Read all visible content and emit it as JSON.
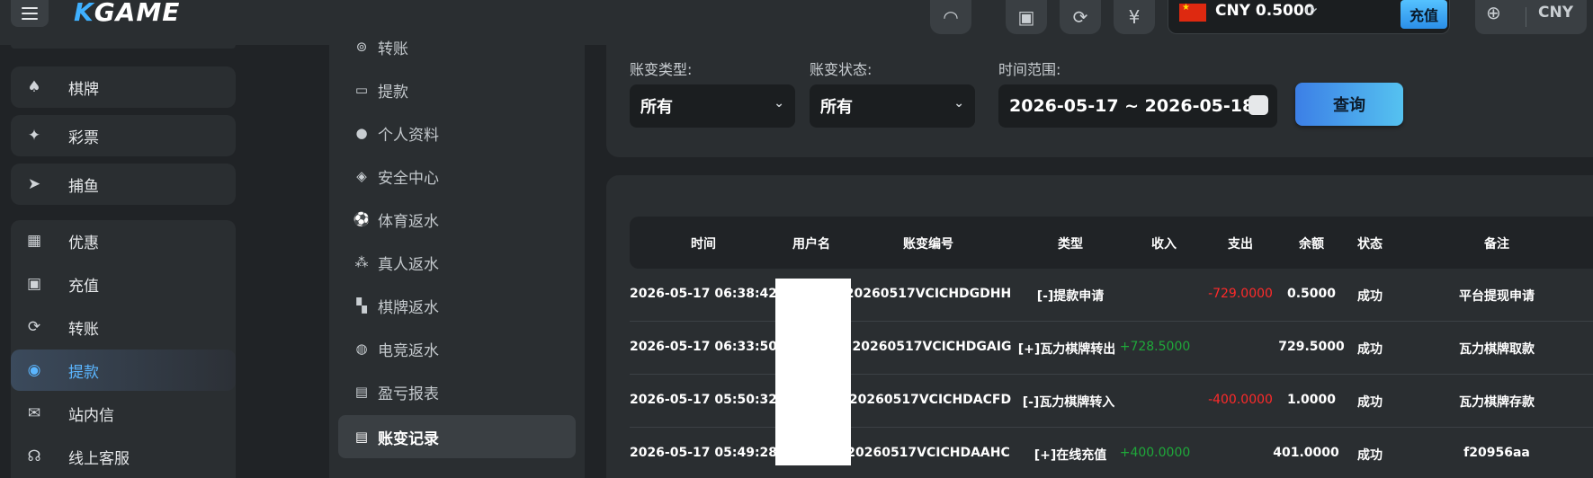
{
  "header": {
    "logo_k": "K",
    "logo_rest": "GAME",
    "balance": "CNY 0.5000",
    "recharge_label": "充值",
    "currency": "CNY"
  },
  "sidebar": {
    "items": [
      {
        "label": "棋牌",
        "icon": "cards-icon"
      },
      {
        "label": "彩票",
        "icon": "lottery-icon"
      },
      {
        "label": "捕鱼",
        "icon": "fish-icon"
      },
      {
        "label": "优惠",
        "icon": "gift-icon"
      },
      {
        "label": "充值",
        "icon": "wallet-icon"
      },
      {
        "label": "转账",
        "icon": "transfer-icon"
      },
      {
        "label": "提款",
        "icon": "withdraw-icon"
      },
      {
        "label": "站内信",
        "icon": "mail-icon"
      },
      {
        "label": "线上客服",
        "icon": "headset-icon"
      }
    ]
  },
  "submenu": {
    "items": [
      {
        "label": "转账"
      },
      {
        "label": "提款"
      },
      {
        "label": "个人资料"
      },
      {
        "label": "安全中心"
      },
      {
        "label": "体育返水"
      },
      {
        "label": "真人返水"
      },
      {
        "label": "棋牌返水"
      },
      {
        "label": "电竞返水"
      },
      {
        "label": "盈亏报表"
      },
      {
        "label": "账变记录"
      }
    ]
  },
  "filters": {
    "type_label": "账变类型:",
    "type_value": "所有",
    "status_label": "账变状态:",
    "status_value": "所有",
    "range_label": "时间范围:",
    "range_value": "2026-05-17 ~ 2026-05-18",
    "query_label": "查询"
  },
  "table": {
    "headers": [
      "时间",
      "用户名",
      "账变编号",
      "类型",
      "收入",
      "支出",
      "余额",
      "状态",
      "备注"
    ],
    "rows": [
      {
        "time": "2026-05-17 06:38:42",
        "user": "",
        "no": "20260517VCICHDGDHH",
        "type": "[-]提款申请",
        "income": "",
        "expense": "-729.0000",
        "balance": "0.5000",
        "status": "成功",
        "note": "平台提现申请"
      },
      {
        "time": "2026-05-17 06:33:50",
        "user": "",
        "no": "20260517VCICHDGAIG",
        "type": "[+]瓦力棋牌转出",
        "income": "+728.5000",
        "expense": "",
        "balance": "729.5000",
        "status": "成功",
        "note": "瓦力棋牌取款"
      },
      {
        "time": "2026-05-17 05:50:32",
        "user": "",
        "no": "20260517VCICHDACFD",
        "type": "[-]瓦力棋牌转入",
        "income": "",
        "expense": "-400.0000",
        "balance": "1.0000",
        "status": "成功",
        "note": "瓦力棋牌存款"
      },
      {
        "time": "2026-05-17 05:49:28",
        "user": "",
        "no": "20260517VCICHDAAHC",
        "type": "[+]在线充值",
        "income": "+400.0000",
        "expense": "",
        "balance": "401.0000",
        "status": "成功",
        "note": "f20956aa"
      }
    ]
  },
  "colors": {
    "accent": "#5bb6ff",
    "income": "#1fa83a",
    "expense": "#ff2a2a"
  }
}
